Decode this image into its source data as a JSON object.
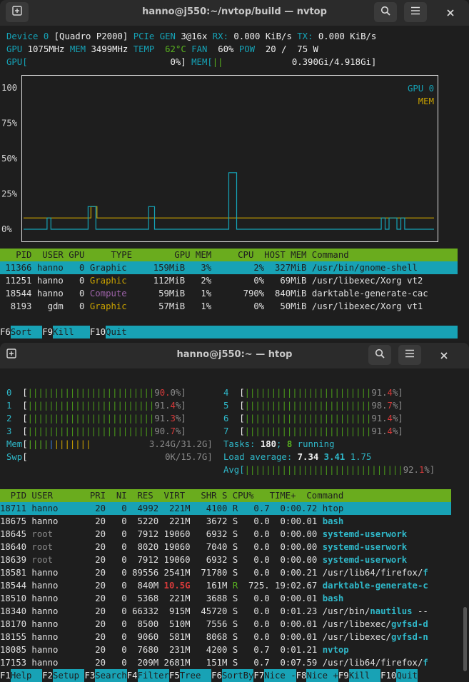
{
  "nvtop": {
    "title": "hanno@j550:~/nvtop/build — nvtop",
    "device_line": {
      "device": "Device 0",
      "name": "[Quadro P2000]",
      "pcie_label": "PCIe GEN",
      "pcie_val": "3@16x",
      "rx_label": "RX:",
      "rx_val": "0.000 KiB/s",
      "tx_label": "TX:",
      "tx_val": "0.000 KiB/s"
    },
    "stats_line": {
      "gpu_label": "GPU",
      "gpu_val": "1075MHz",
      "mem_label": "MEM",
      "mem_val": "3499MHz",
      "temp_label": "TEMP",
      "temp_val": "62°C",
      "fan_label": "FAN",
      "fan_val": "60%",
      "pow_label": "POW",
      "pow_val": "20 /  75 W"
    },
    "bars_line": {
      "gpu_label": "GPU[",
      "gpu_val": "0%]",
      "mem_label": "MEM[",
      "mem_bars": "||",
      "mem_val": "0.390Gi/4.918Gi]"
    },
    "chart_data": {
      "type": "line",
      "title": "",
      "y_ticks": [
        "100",
        "75%",
        "50%",
        "25%",
        "0%"
      ],
      "ylim": [
        0,
        100
      ],
      "legend": [
        "GPU 0",
        "MEM"
      ],
      "legend_position": "top-right",
      "series": [
        {
          "name": "GPU 0",
          "color": "#15a3b7",
          "values": [
            0,
            0,
            0,
            0,
            0,
            0,
            0,
            0,
            0,
            0,
            0,
            0,
            8,
            8,
            0,
            0,
            0,
            0,
            0,
            0,
            0,
            0,
            0,
            0,
            0,
            0,
            0,
            0,
            0,
            0,
            0,
            0,
            0,
            16,
            16,
            16,
            16,
            0,
            0,
            0,
            0,
            0,
            0,
            0,
            0,
            0,
            0,
            0,
            0,
            0,
            0,
            0,
            0,
            0,
            0,
            0,
            0,
            0,
            0,
            0,
            0,
            0,
            0,
            0,
            16,
            16,
            16,
            0,
            0,
            0,
            0,
            0,
            0,
            0,
            0,
            0,
            0,
            0,
            0,
            0,
            0,
            0,
            0,
            0,
            0,
            0,
            0,
            0,
            0,
            0,
            0,
            0,
            0,
            0,
            0,
            0,
            0,
            0,
            0,
            0,
            0,
            0,
            0,
            0,
            0,
            40,
            40,
            40,
            40,
            0,
            0,
            0,
            0,
            0,
            0,
            0,
            0,
            0,
            0,
            0,
            0,
            0,
            0,
            0,
            0,
            0,
            0,
            0,
            0,
            0,
            0,
            0,
            0,
            0,
            0,
            0,
            0,
            0,
            0,
            0,
            0,
            0,
            0,
            0,
            0,
            0,
            0,
            0,
            0,
            0,
            0,
            0,
            0,
            0,
            0,
            0,
            0,
            0,
            0,
            0,
            0,
            0,
            0,
            0,
            0,
            0,
            0,
            0,
            0,
            0,
            0,
            0,
            0,
            0,
            0,
            0,
            0,
            0,
            0,
            0,
            0,
            0,
            0,
            8,
            8,
            0,
            0,
            8,
            8,
            8,
            8,
            0,
            0,
            8,
            8,
            0,
            0,
            0,
            0,
            0,
            0,
            0,
            0,
            0,
            0,
            0,
            0,
            0,
            0,
            0
          ]
        },
        {
          "name": "MEM",
          "color": "#c8a100",
          "values": [
            8,
            8,
            8,
            8,
            8,
            8,
            8,
            8,
            8,
            8,
            8,
            8,
            8,
            8,
            8,
            8,
            8,
            8,
            8,
            8,
            8,
            8,
            8,
            8,
            8,
            8,
            8,
            8,
            8,
            8,
            8,
            8,
            8,
            8,
            16,
            16,
            16,
            8,
            8,
            8,
            8,
            8,
            8,
            8,
            8,
            8,
            8,
            8,
            8,
            8,
            8,
            8,
            8,
            8,
            8,
            8,
            8,
            8,
            8,
            8,
            8,
            8,
            8,
            8,
            8,
            8,
            8,
            8,
            8,
            8,
            8,
            8,
            8,
            8,
            8,
            8,
            8,
            8,
            8,
            8,
            8,
            8,
            8,
            8,
            8,
            8,
            8,
            8,
            8,
            8,
            8,
            8,
            8,
            8,
            8,
            8,
            8,
            8,
            8,
            8,
            8,
            8,
            8,
            8,
            8,
            8,
            8,
            8,
            8,
            8,
            8,
            8,
            8,
            8,
            8,
            8,
            8,
            8,
            8,
            8,
            8,
            8,
            8,
            8,
            8,
            8,
            8,
            8,
            8,
            8,
            8,
            8,
            8,
            8,
            8,
            8,
            8,
            8,
            8,
            8,
            8,
            8,
            8,
            8,
            8,
            8,
            8,
            8,
            8,
            8,
            8,
            8,
            8,
            8,
            8,
            8,
            8,
            8,
            8,
            8,
            8,
            8,
            8,
            8,
            8,
            8,
            8,
            8,
            8,
            8,
            8,
            8,
            8,
            8,
            8,
            8,
            8,
            8,
            8,
            8,
            8,
            8,
            8,
            8,
            8,
            8,
            8,
            8,
            8,
            8,
            8,
            8,
            8,
            8,
            8,
            8,
            8,
            8,
            8,
            8,
            8,
            8,
            8,
            8,
            8,
            8,
            8
          ]
        }
      ]
    },
    "proc_header": "   PID  USER GPU     TYPE        GPU MEM     CPU  HOST MEM Command",
    "processes": [
      {
        "pid": "11366",
        "user": "hanno",
        "gpu": "0",
        "type": "Graphic",
        "gpumem": "159MiB",
        "gpupct": "3%",
        "cpu": "2%",
        "hostmem": "327MiB",
        "cmd": "/usr/bin/gnome-shell"
      },
      {
        "pid": "11251",
        "user": "hanno",
        "gpu": "0",
        "type": "Graphic",
        "gpumem": "112MiB",
        "gpupct": "2%",
        "cpu": "0%",
        "hostmem": "69MiB",
        "cmd": "/usr/libexec/Xorg vt2"
      },
      {
        "pid": "18544",
        "user": "hanno",
        "gpu": "0",
        "type": "Compute",
        "gpumem": "59MiB",
        "gpupct": "1%",
        "cpu": "790%",
        "hostmem": "840MiB",
        "cmd": "darktable-generate-cac"
      },
      {
        "pid": "8193",
        "user": "gdm",
        "gpu": "0",
        "type": "Graphic",
        "gpumem": "57MiB",
        "gpupct": "1%",
        "cpu": "0%",
        "hostmem": "50MiB",
        "cmd": "/usr/libexec/Xorg vt1"
      }
    ],
    "fkeys": [
      {
        "key": "F6",
        "label": "Sort  "
      },
      {
        "key": "F9",
        "label": "Kill   "
      },
      {
        "key": "F10",
        "label": "Quit"
      }
    ]
  },
  "htop": {
    "title": "hanno@j550:~ — htop",
    "cpus_left": [
      {
        "id": "0",
        "bars": "||||||||||||||||||||||||9",
        "red": "0.",
        "tail": "0%]"
      },
      {
        "id": "1",
        "bars": "||||||||||||||||||||||||91.",
        "red": "4",
        "tail": "%]"
      },
      {
        "id": "2",
        "bars": "||||||||||||||||||||||||91.",
        "red": "3",
        "tail": "%]"
      },
      {
        "id": "3",
        "bars": "||||||||||||||||||||||||90.",
        "red": "7",
        "tail": "%]"
      }
    ],
    "cpus_right": [
      {
        "id": "4",
        "bars": "||||||||||||||||||||||||91.",
        "red": "4",
        "tail": "%]"
      },
      {
        "id": "5",
        "bars": "||||||||||||||||||||||||98.",
        "red": "7",
        "tail": "%]"
      },
      {
        "id": "6",
        "bars": "||||||||||||||||||||||||91.",
        "red": "4",
        "tail": "%]"
      },
      {
        "id": "7",
        "bars": "||||||||||||||||||||||||91.",
        "red": "4",
        "tail": "%]"
      }
    ],
    "mem": {
      "label": "Mem",
      "val": "3.24G/31.2G]"
    },
    "swp": {
      "label": "Swp",
      "val": "0K/15.7G]"
    },
    "tasks": {
      "label": "Tasks:",
      "count": "180",
      "sep": ";",
      "running": "8",
      "running_label": "running"
    },
    "load": {
      "label": "Load average:",
      "l1": "7.34",
      "l5": "3.41",
      "l15": "1.75"
    },
    "avg": {
      "label": "Avg[",
      "bars": "||||||||||||||||||||||||||||||92.",
      "red": "1",
      "tail": "%]"
    },
    "header": "  PID USER       PRI  NI  RES  VIRT   SHR S CPU%   TIME+  Command",
    "rows": [
      {
        "pid": "18711",
        "user": "hanno",
        "pri": "20",
        "ni": "0",
        "res": "4992",
        "virt": "221M",
        "shr": "4100",
        "s": "R",
        "cpu": "0.7",
        "time": "0:00.72",
        "cmd": "htop",
        "selected": true
      },
      {
        "pid": "18675",
        "user": "hanno",
        "pri": "20",
        "ni": "0",
        "res": "5220",
        "virt": "221M",
        "shr": "3672",
        "s": "S",
        "cpu": "0.0",
        "time": "0:00.01",
        "cmd": "bash"
      },
      {
        "pid": "18645",
        "user": "root",
        "pri": "20",
        "ni": "0",
        "res": "7912",
        "virt": "19060",
        "shr": "6932",
        "s": "S",
        "cpu": "0.0",
        "time": "0:00.00",
        "cmd": "systemd-userwork"
      },
      {
        "pid": "18640",
        "user": "root",
        "pri": "20",
        "ni": "0",
        "res": "8020",
        "virt": "19060",
        "shr": "7040",
        "s": "S",
        "cpu": "0.0",
        "time": "0:00.00",
        "cmd": "systemd-userwork"
      },
      {
        "pid": "18639",
        "user": "root",
        "pri": "20",
        "ni": "0",
        "res": "7912",
        "virt": "19060",
        "shr": "6932",
        "s": "S",
        "cpu": "0.0",
        "time": "0:00.00",
        "cmd": "systemd-userwork"
      },
      {
        "pid": "18581",
        "user": "hanno",
        "pri": "20",
        "ni": "0",
        "res": "89556",
        "virt": "2541M",
        "shr": "71780",
        "s": "S",
        "cpu": "0.0",
        "time": "0:00.21",
        "cmd": "/usr/lib64/firefox/f"
      },
      {
        "pid": "18544",
        "user": "hanno",
        "pri": "20",
        "ni": "0",
        "res": "840M",
        "virt": "10.5G",
        "shr": "161M",
        "s": "R",
        "cpu": "725.",
        "time": "19:02.67",
        "cmd": "darktable-generate-c"
      },
      {
        "pid": "18510",
        "user": "hanno",
        "pri": "20",
        "ni": "0",
        "res": "5368",
        "virt": "221M",
        "shr": "3688",
        "s": "S",
        "cpu": "0.0",
        "time": "0:00.01",
        "cmd": "bash"
      },
      {
        "pid": "18340",
        "user": "hanno",
        "pri": "20",
        "ni": "0",
        "res": "66332",
        "virt": "915M",
        "shr": "45720",
        "s": "S",
        "cpu": "0.0",
        "time": "0:01.23",
        "cmd": "/usr/bin/nautilus --"
      },
      {
        "pid": "18170",
        "user": "hanno",
        "pri": "20",
        "ni": "0",
        "res": "8500",
        "virt": "510M",
        "shr": "7556",
        "s": "S",
        "cpu": "0.0",
        "time": "0:00.01",
        "cmd": "/usr/libexec/gvfsd-d"
      },
      {
        "pid": "18155",
        "user": "hanno",
        "pri": "20",
        "ni": "0",
        "res": "9060",
        "virt": "581M",
        "shr": "8068",
        "s": "S",
        "cpu": "0.0",
        "time": "0:00.01",
        "cmd": "/usr/libexec/gvfsd-n"
      },
      {
        "pid": "18085",
        "user": "hanno",
        "pri": "20",
        "ni": "0",
        "res": "7680",
        "virt": "231M",
        "shr": "4200",
        "s": "S",
        "cpu": "0.7",
        "time": "0:01.21",
        "cmd": "nvtop"
      },
      {
        "pid": "17153",
        "user": "hanno",
        "pri": "20",
        "ni": "0",
        "res": "209M",
        "virt": "2681M",
        "shr": "151M",
        "s": "S",
        "cpu": "0.7",
        "time": "0:07.59",
        "cmd": "/usr/lib64/firefox/f"
      }
    ],
    "fkeys": [
      {
        "key": "F1",
        "label": "Help  "
      },
      {
        "key": "F2",
        "label": "Setup "
      },
      {
        "key": "F3",
        "label": "Search"
      },
      {
        "key": "F4",
        "label": "Filter"
      },
      {
        "key": "F5",
        "label": "Tree  "
      },
      {
        "key": "F6",
        "label": "SortBy"
      },
      {
        "key": "F7",
        "label": "Nice -"
      },
      {
        "key": "F8",
        "label": "Nice +"
      },
      {
        "key": "F9",
        "label": "Kill  "
      },
      {
        "key": "F10",
        "label": "Quit"
      }
    ]
  }
}
